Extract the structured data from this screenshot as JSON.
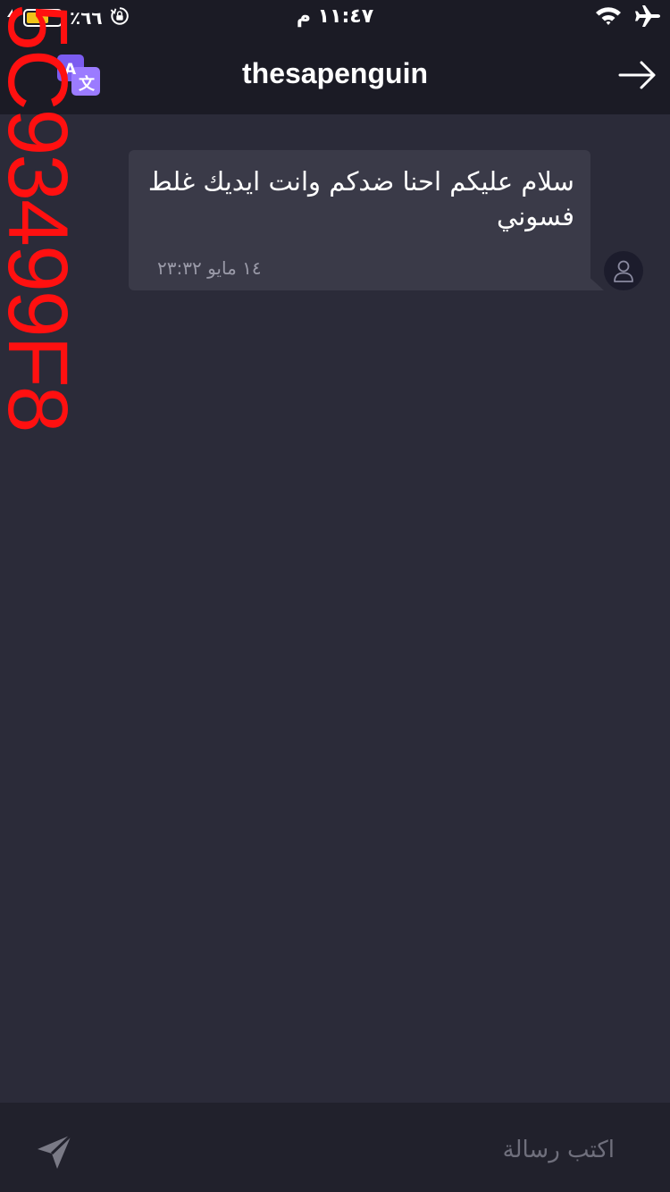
{
  "status_bar": {
    "time": "١١:٤٧ م",
    "battery_percent": "٦٦٪",
    "battery_level": 0.66,
    "charging_icon": "bolt-icon",
    "lock_icon": "orientation-lock-icon",
    "wifi_icon": "wifi-icon",
    "airplane_icon": "airplane-icon"
  },
  "header": {
    "title": "thesapenguin",
    "translate_icon": "translate-icon",
    "back_icon": "arrow-right-icon"
  },
  "messages": [
    {
      "text": "سلام عليكم احنا ضدكم وانت ايديك غلط فسوني",
      "time": "١٤ مايو ٢٣:٣٢",
      "avatar_icon": "user-icon"
    }
  ],
  "composer": {
    "placeholder": "اكتب رسالة",
    "send_icon": "send-icon"
  },
  "watermark": "5C93499F8",
  "colors": {
    "background": "#2b2b39",
    "header": "#1b1b25",
    "bubble": "#3a3a48",
    "translate_accent": "#8b6cf0",
    "watermark": "#ff1010"
  }
}
